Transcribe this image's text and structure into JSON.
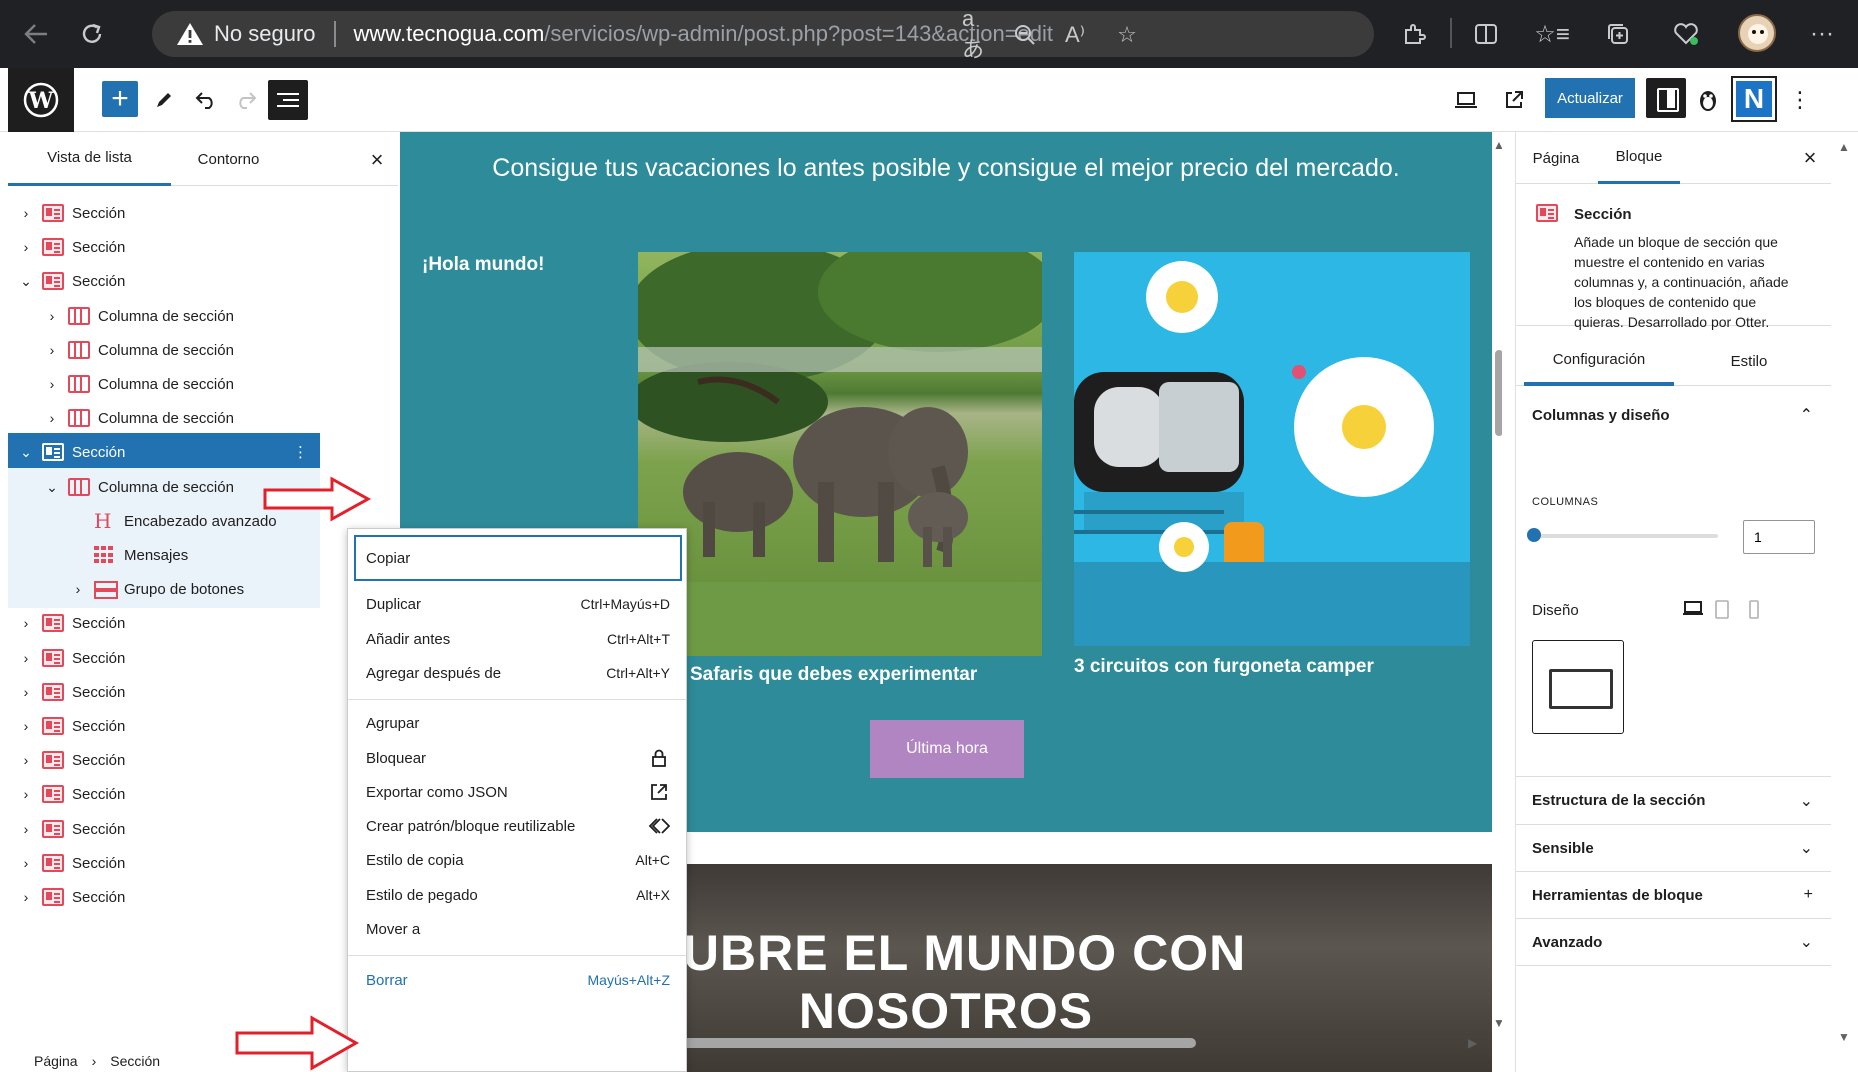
{
  "browser": {
    "security_label": "No seguro",
    "url_host": "www.tecnogua.com",
    "url_path": "/servicios/wp-admin/post.php?post=143&action=edit",
    "icons": [
      "back-icon",
      "refresh-icon",
      "warning-icon",
      "translate-icon",
      "zoom-out-icon",
      "read-aloud-icon",
      "favorite-icon",
      "extensions-icon",
      "split-screen-icon",
      "favorites-icon",
      "collections-icon",
      "health-icon",
      "profile-avatar",
      "more-icon"
    ]
  },
  "toolbar": {
    "update_label": "Actualizar",
    "n_label": "N"
  },
  "left_panel": {
    "tab_list": "Vista de lista",
    "tab_outline": "Contorno",
    "close_glyph": "×",
    "items": [
      {
        "label": "Sección",
        "indent": 0,
        "expanded": false,
        "icon": "section"
      },
      {
        "label": "Sección",
        "indent": 0,
        "expanded": false,
        "icon": "section"
      },
      {
        "label": "Sección",
        "indent": 0,
        "expanded": true,
        "icon": "section"
      },
      {
        "label": "Columna de sección",
        "indent": 1,
        "expanded": false,
        "icon": "column"
      },
      {
        "label": "Columna de sección",
        "indent": 1,
        "expanded": false,
        "icon": "column"
      },
      {
        "label": "Columna de sección",
        "indent": 1,
        "expanded": false,
        "icon": "column"
      },
      {
        "label": "Columna de sección",
        "indent": 1,
        "expanded": false,
        "icon": "column"
      },
      {
        "label": "Sección",
        "indent": 0,
        "expanded": true,
        "icon": "section",
        "selected": true
      },
      {
        "label": "Columna de sección",
        "indent": 1,
        "expanded": true,
        "icon": "column"
      },
      {
        "label": "Encabezado avanzado",
        "indent": 2,
        "icon": "heading"
      },
      {
        "label": "Mensajes",
        "indent": 2,
        "icon": "grid"
      },
      {
        "label": "Grupo de botones",
        "indent": 2,
        "expanded": false,
        "icon": "buttons"
      },
      {
        "label": "Sección",
        "indent": 0,
        "expanded": false,
        "icon": "section"
      },
      {
        "label": "Sección",
        "indent": 0,
        "expanded": false,
        "icon": "section"
      },
      {
        "label": "Sección",
        "indent": 0,
        "expanded": false,
        "icon": "section"
      },
      {
        "label": "Sección",
        "indent": 0,
        "expanded": false,
        "icon": "section"
      },
      {
        "label": "Sección",
        "indent": 0,
        "expanded": false,
        "icon": "section"
      },
      {
        "label": "Sección",
        "indent": 0,
        "expanded": false,
        "icon": "section"
      },
      {
        "label": "Sección",
        "indent": 0,
        "expanded": false,
        "icon": "section"
      },
      {
        "label": "Sección",
        "indent": 0,
        "expanded": false,
        "icon": "section"
      },
      {
        "label": "Sección",
        "indent": 0,
        "expanded": false,
        "icon": "section"
      }
    ],
    "breadcrumb": [
      "Página",
      "›",
      "Sección"
    ]
  },
  "canvas": {
    "headline": "Consigue tus vacaciones lo antes posible y consigue el mejor precio del mercado.",
    "hola": "¡Hola mundo!",
    "caption_1": "Safaris que debes experimentar",
    "caption_2": "3 circuitos con furgoneta camper",
    "button_label": "Última hora",
    "water_title_line1": "CUBRE EL MUNDO CON",
    "water_title_line2": "NOSOTROS",
    "colors": {
      "teal": "#2e8b9a",
      "button": "#b085c1"
    }
  },
  "context_menu": {
    "group1": [
      {
        "label": "Copiar",
        "shortcut": ""
      },
      {
        "label": "Duplicar",
        "shortcut": "Ctrl+Mayús+D"
      },
      {
        "label": "Añadir antes",
        "shortcut": "Ctrl+Alt+T"
      },
      {
        "label": "Agregar después de",
        "shortcut": "Ctrl+Alt+Y"
      }
    ],
    "group2": [
      {
        "label": "Agrupar",
        "shortcut": "",
        "icon": ""
      },
      {
        "label": "Bloquear",
        "shortcut": "",
        "icon": "lock-icon"
      },
      {
        "label": "Exportar como JSON",
        "shortcut": "",
        "icon": "external-icon"
      },
      {
        "label": "Crear patrón/bloque reutilizable",
        "shortcut": "",
        "icon": "pattern-icon"
      },
      {
        "label": "Estilo de copia",
        "shortcut": "Alt+C",
        "icon": ""
      },
      {
        "label": "Estilo de pegado",
        "shortcut": "Alt+X",
        "icon": ""
      },
      {
        "label": "Mover a",
        "shortcut": "",
        "icon": ""
      }
    ],
    "delete": {
      "label": "Borrar",
      "shortcut": "Mayús+Alt+Z"
    }
  },
  "right_panel": {
    "tab_pagina": "Página",
    "tab_bloque": "Bloque",
    "close_glyph": "×",
    "block_title": "Sección",
    "block_desc": "Añade un bloque de sección que muestre el contenido en varias columnas y, a continuación, añade los bloques de contenido que quieras. Desarrollado por Otter.",
    "tab_config": "Configuración",
    "tab_estilo": "Estilo",
    "section_columns": "Columnas y diseño",
    "columns_label": "COLUMNAS",
    "columns_value": "1",
    "design_label": "Diseño",
    "sections": [
      {
        "label": "Estructura de la sección",
        "toggle": "⌄"
      },
      {
        "label": "Sensible",
        "toggle": "⌄"
      },
      {
        "label": "Herramientas de bloque",
        "toggle": "+"
      },
      {
        "label": "Avanzado",
        "toggle": "⌄"
      }
    ]
  }
}
